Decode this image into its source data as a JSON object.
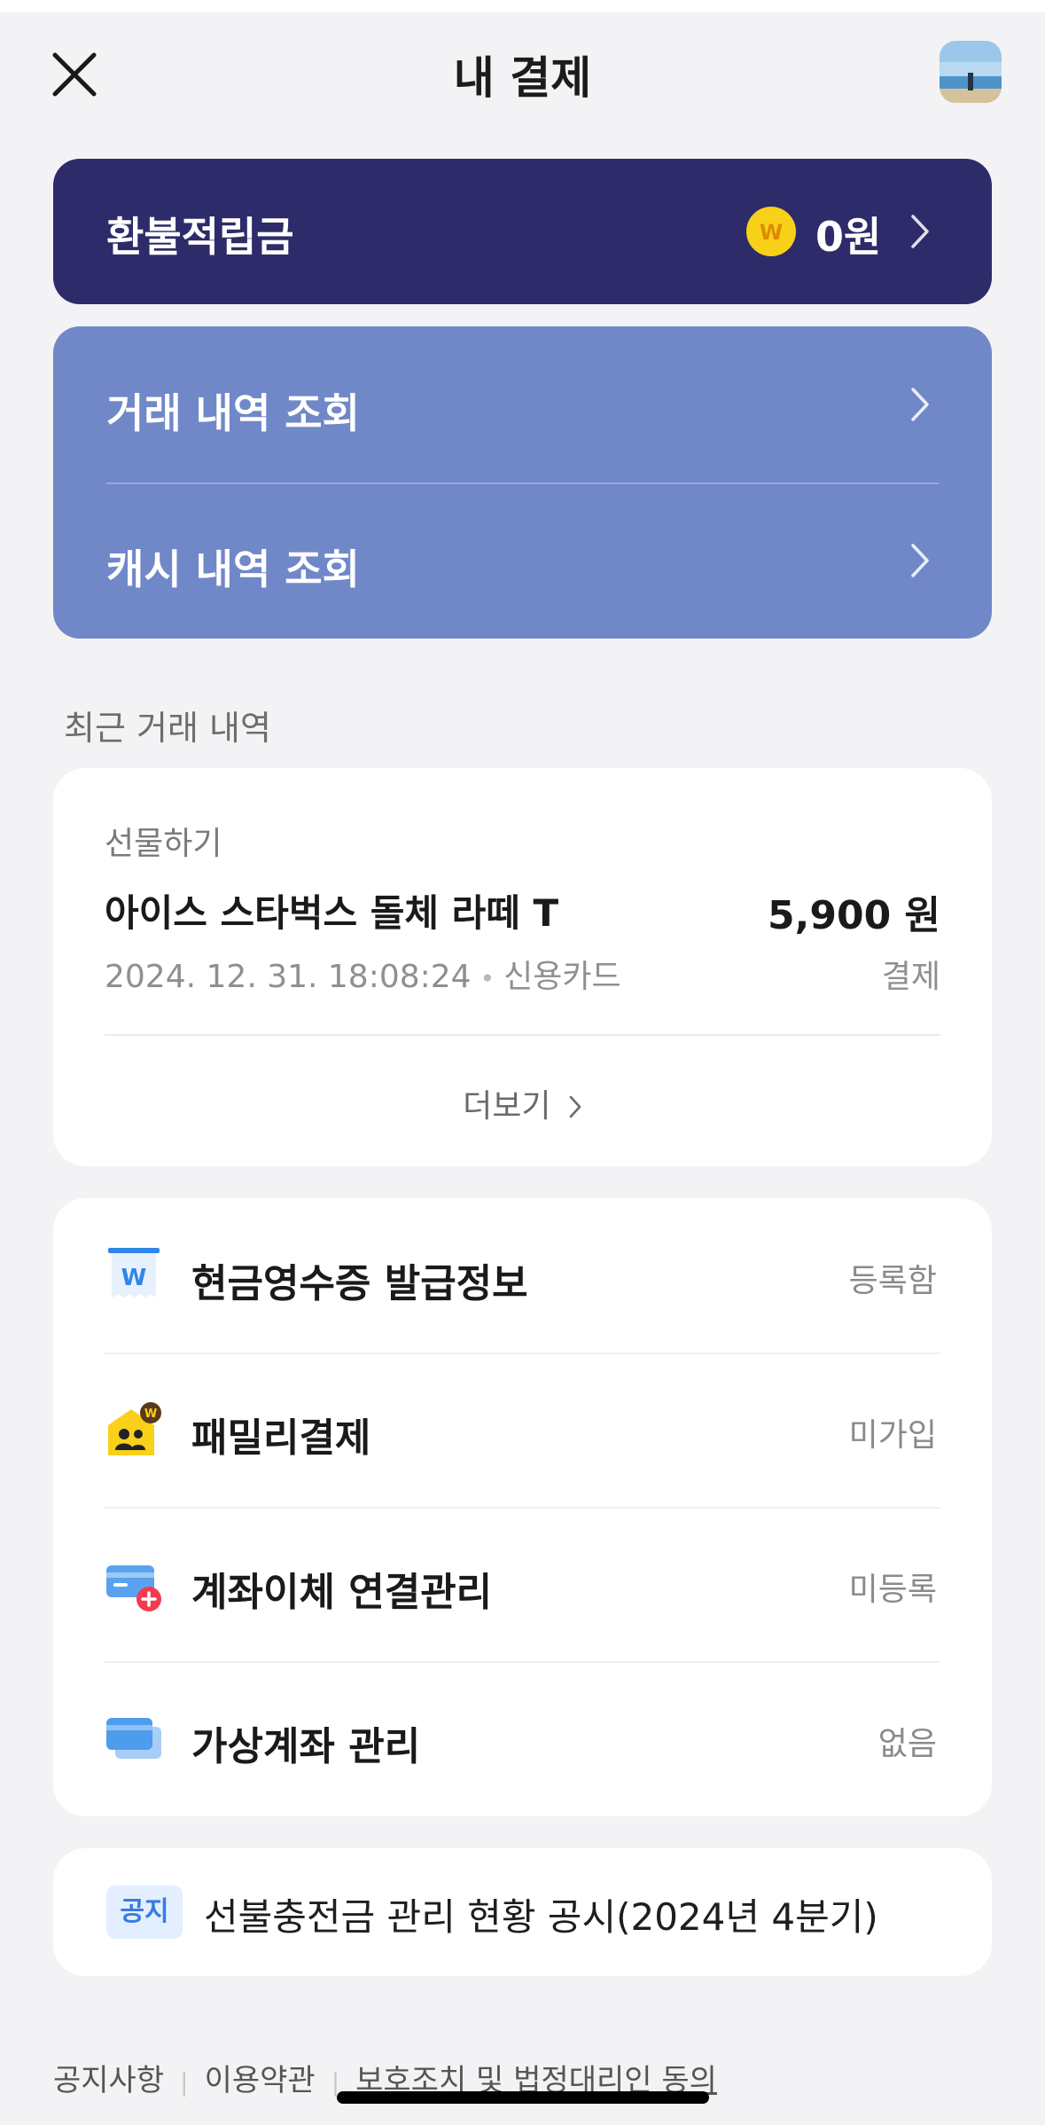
{
  "header": {
    "title": "내 결제",
    "close_icon": "close-icon",
    "avatar": "profile-avatar"
  },
  "refund": {
    "label": "환불적립금",
    "coin_symbol": "W",
    "value": "0원"
  },
  "history": {
    "items": [
      {
        "label": "거래 내역 조회"
      },
      {
        "label": "캐시 내역 조회"
      }
    ]
  },
  "recent": {
    "section_title": "최근 거래 내역",
    "category": "선물하기",
    "name": "아이스 스타벅스 돌체 라떼 T",
    "amount": "5,900 원",
    "datetime": "2024. 12. 31. 18:08:24",
    "method": "신용카드",
    "status": "결제",
    "more": "더보기"
  },
  "menu": {
    "items": [
      {
        "label": "현금영수증 발급정보",
        "status": "등록함",
        "icon": "cash-receipt-icon"
      },
      {
        "label": "패밀리결제",
        "status": "미가입",
        "icon": "family-pay-icon"
      },
      {
        "label": "계좌이체 연결관리",
        "status": "미등록",
        "icon": "bank-card-add-icon"
      },
      {
        "label": "가상계좌 관리",
        "status": "없음",
        "icon": "virtual-account-icon"
      }
    ]
  },
  "notice": {
    "badge": "공지",
    "text": "선불충전금 관리 현황 공시(2024년 4분기)"
  },
  "footer": {
    "links": [
      "공지사항",
      "이용약관",
      "보호조치 및 법정대리인 동의"
    ]
  },
  "colors": {
    "refund_bg": "#2e2b6b",
    "history_bg": "#7088c8",
    "page_bg": "#f3f3f5",
    "coin": "#f7d117",
    "notice_badge": "#3a7be0"
  }
}
